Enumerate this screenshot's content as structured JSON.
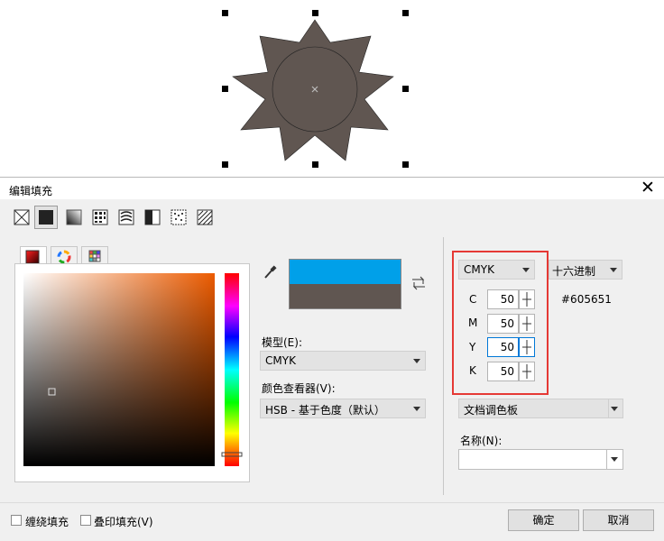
{
  "colors": {
    "fill": "#605651",
    "new_color": "#00a0e9",
    "highlight": "#e53935"
  },
  "dialog": {
    "title": "编辑填充",
    "fill_types": [
      "no-fill-icon",
      "uniform-fill-icon",
      "fountain-fill-icon",
      "vector-pattern-icon",
      "bitmap-pattern-icon",
      "two-color-pattern-icon",
      "texture-fill-icon",
      "postscript-fill-icon"
    ],
    "picker_tabs": [
      "color-viewer-icon",
      "color-wheel-icon",
      "color-palette-grid-icon"
    ],
    "model_label": "模型(E):",
    "model_value": "CMYK",
    "viewer_label": "颜色查看器(V):",
    "viewer_value": "HSB - 基于色度（默认）",
    "color_model_value": "CMYK",
    "format_value": "十六进制",
    "hex_value": "#605651",
    "cmyk": [
      {
        "label": "C",
        "value": "50"
      },
      {
        "label": "M",
        "value": "50"
      },
      {
        "label": "Y",
        "value": "50"
      },
      {
        "label": "K",
        "value": "50"
      }
    ],
    "palette_value": "文档调色板",
    "name_label": "名称(N):",
    "name_value": "",
    "wrap_fill_label": "缠绕填充",
    "overprint_label": "叠印填充(V)",
    "ok_label": "确定",
    "cancel_label": "取消"
  }
}
